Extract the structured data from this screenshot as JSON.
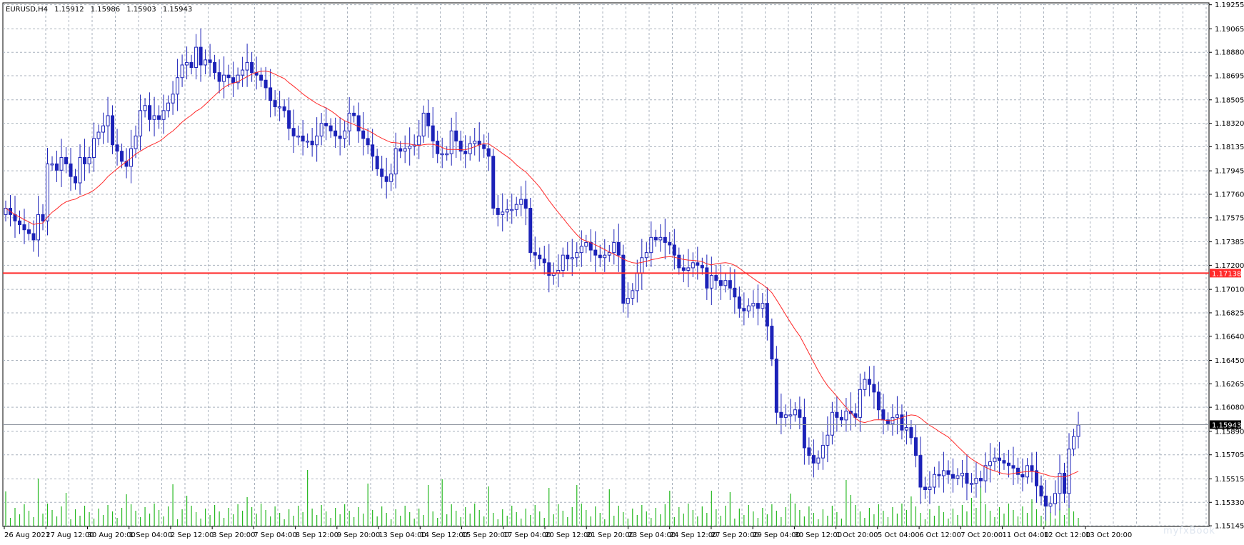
{
  "header": {
    "symbol": "EURUSD,H4",
    "open": "1.15912",
    "high": "1.15986",
    "low": "1.15903",
    "close": "1.15943"
  },
  "watermark": "myfxBook",
  "colors": {
    "background": "#ffffff",
    "grid": "#a9b2bd",
    "candle": "#1c22b8",
    "volume": "#25b820",
    "moving_average": "#ff2a2a",
    "horizontal_line": "#ff2a2a",
    "bid_line": "#8f96a0",
    "axis": "#000000"
  },
  "chart_data": {
    "type": "candlestick",
    "symbol": "EURUSD",
    "timeframe": "H4",
    "ylim": [
      1.1514,
      1.1927
    ],
    "grid": true,
    "price_ticks": [
      "1.19255",
      "1.19065",
      "1.18880",
      "1.18695",
      "1.18505",
      "1.18320",
      "1.18135",
      "1.17945",
      "1.17760",
      "1.17575",
      "1.17385",
      "1.17200",
      "1.17010",
      "1.16825",
      "1.16640",
      "1.16450",
      "1.16265",
      "1.16080",
      "1.15890",
      "1.15705",
      "1.15515",
      "1.15330",
      "1.15145"
    ],
    "time_labels": [
      "26 Aug 2021",
      "27 Aug 12:00",
      "30 Aug 20:00",
      "1 Sep 04:00",
      "2 Sep 12:00",
      "3 Sep 20:00",
      "7 Sep 04:00",
      "8 Sep 12:00",
      "9 Sep 20:00",
      "13 Sep 04:00",
      "14 Sep 12:00",
      "15 Sep 20:00",
      "17 Sep 04:00",
      "20 Sep 12:00",
      "21 Sep 20:00",
      "23 Sep 04:00",
      "24 Sep 12:00",
      "27 Sep 20:00",
      "29 Sep 04:00",
      "30 Sep 12:00",
      "1 Oct 20:00",
      "5 Oct 04:00",
      "6 Oct 12:00",
      "7 Oct 20:00",
      "11 Oct 04:00",
      "12 Oct 12:00",
      "13 Oct 20:00"
    ],
    "horizontal_line": {
      "label": "1.17138",
      "value": 1.17138
    },
    "bid_line": {
      "label": "1.15943",
      "value": 1.15943
    },
    "close": [
      1.1765,
      1.176,
      1.1755,
      1.1752,
      1.1748,
      1.1745,
      1.174,
      1.176,
      1.1755,
      1.18,
      1.18,
      1.1795,
      1.1805,
      1.18,
      1.179,
      1.1785,
      1.1805,
      1.18,
      1.1805,
      1.182,
      1.1825,
      1.183,
      1.1838,
      1.1815,
      1.181,
      1.1802,
      1.1798,
      1.1812,
      1.1822,
      1.1842,
      1.1846,
      1.1835,
      1.1838,
      1.1835,
      1.1842,
      1.1848,
      1.1855,
      1.1868,
      1.1878,
      1.188,
      1.1876,
      1.1892,
      1.1878,
      1.1882,
      1.188,
      1.1872,
      1.1865,
      1.187,
      1.1868,
      1.1864,
      1.187,
      1.1874,
      1.188,
      1.1872,
      1.187,
      1.1866,
      1.186,
      1.185,
      1.1845,
      1.1845,
      1.1842,
      1.1828,
      1.1822,
      1.1822,
      1.1818,
      1.1818,
      1.1815,
      1.1822,
      1.1832,
      1.183,
      1.1826,
      1.1822,
      1.182,
      1.1826,
      1.184,
      1.1838,
      1.1826,
      1.182,
      1.1815,
      1.1806,
      1.1796,
      1.179,
      1.1786,
      1.1792,
      1.1812,
      1.181,
      1.1812,
      1.1814,
      1.1815,
      1.1822,
      1.184,
      1.183,
      1.1818,
      1.1808,
      1.1808,
      1.1808,
      1.1826,
      1.1818,
      1.181,
      1.1808,
      1.1816,
      1.1818,
      1.1815,
      1.1812,
      1.1806,
      1.1765,
      1.176,
      1.1762,
      1.1764,
      1.1764,
      1.1768,
      1.1772,
      1.1765,
      1.173,
      1.1728,
      1.1725,
      1.1722,
      1.1712,
      1.1714,
      1.1716,
      1.1728,
      1.1725,
      1.1726,
      1.173,
      1.1735,
      1.1738,
      1.1732,
      1.1728,
      1.1726,
      1.1728,
      1.173,
      1.1738,
      1.1728,
      1.169,
      1.1694,
      1.17,
      1.1714,
      1.1726,
      1.173,
      1.1742,
      1.174,
      1.1742,
      1.1738,
      1.1736,
      1.1728,
      1.1718,
      1.1716,
      1.1718,
      1.1722,
      1.172,
      1.1718,
      1.1702,
      1.1712,
      1.1708,
      1.1704,
      1.1708,
      1.1702,
      1.1695,
      1.1686,
      1.1684,
      1.1688,
      1.169,
      1.1686,
      1.169,
      1.1672,
      1.1646,
      1.1604,
      1.16,
      1.1602,
      1.1602,
      1.1606,
      1.16,
      1.1576,
      1.157,
      1.1564,
      1.1568,
      1.1578,
      1.1586,
      1.1604,
      1.16,
      1.1598,
      1.1605,
      1.1603,
      1.16,
      1.1622,
      1.163,
      1.1626,
      1.162,
      1.1606,
      1.1598,
      1.1595,
      1.16,
      1.1602,
      1.159,
      1.1592,
      1.1584,
      1.157,
      1.1545,
      1.1543,
      1.1545,
      1.1555,
      1.1554,
      1.1558,
      1.1555,
      1.1552,
      1.1554,
      1.1556,
      1.1548,
      1.1548,
      1.1552,
      1.155,
      1.1562,
      1.1565,
      1.1568,
      1.1566,
      1.1564,
      1.1562,
      1.156,
      1.1555,
      1.1553,
      1.1562,
      1.1558,
      1.1546,
      1.1538,
      1.153,
      1.1532,
      1.154,
      1.1556,
      1.154,
      1.1575,
      1.1585,
      1.1594
    ]
  }
}
